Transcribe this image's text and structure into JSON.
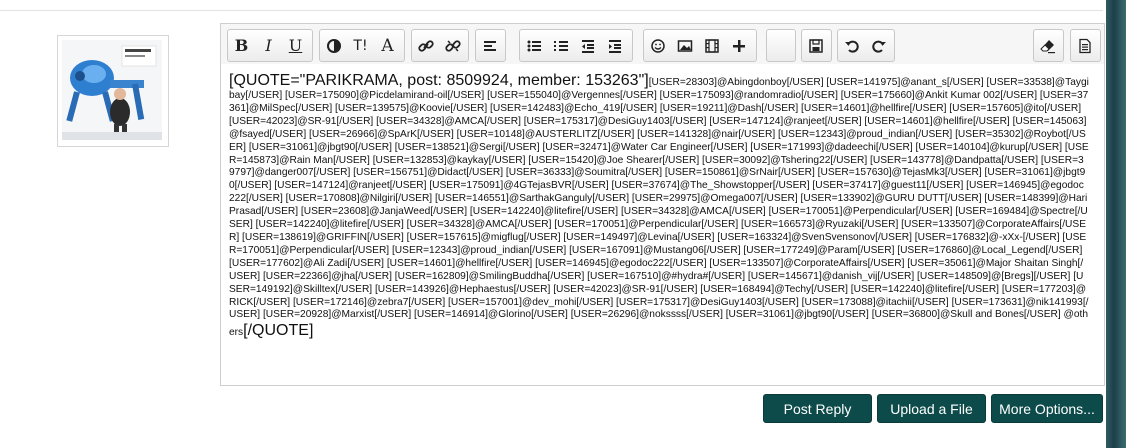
{
  "toolbar": {
    "icons": [
      "bold-icon",
      "italic-icon",
      "underline-icon",
      "color-icon",
      "text-size-icon",
      "font-icon",
      "link-icon",
      "unlink-icon",
      "align-icon",
      "bullet-list-icon",
      "numbered-list-icon",
      "outdent-icon",
      "indent-icon",
      "smilie-icon",
      "image-icon",
      "media-icon",
      "insert-icon",
      "blank",
      "save-icon",
      "undo-icon",
      "redo-icon",
      "remove-format-icon",
      "source-icon"
    ],
    "bold_label": "B",
    "italic_label": "I",
    "underline_label": "U",
    "size_label": "T!",
    "font_label": "A"
  },
  "editor": {
    "quote_open": "[QUOTE=\"PARIKRAMA, post: 8509924, member: 153263\"]",
    "body_text": "[USER=28303]@Abingdonboy[/USER] [USER=141975]@anant_s[/USER] [USER=33538]@Taygibay[/USER] [USER=175090]@Picdelamirand-oil[/USER] [USER=155040]@Vergennes[/USER] [USER=175093]@randomradio[/USER] [USER=175660]@Ankit Kumar 002[/USER] [USER=37361]@MilSpec[/USER] [USER=139575]@Koovie[/USER] [USER=142483]@Echo_419[/USER] [USER=19211]@Dash[/USER] [USER=14601]@hellfire[/USER] [USER=157605]@ito[/USER] [USER=42023]@SR-91[/USER] [USER=34328]@AMCA[/USER] [USER=175317]@DesiGuy1403[/USER] [USER=147124]@ranjeet[/USER] [USER=14601]@hellfire[/USER] [USER=145063]@fsayed[/USER] [USER=26966]@SpArK[/USER] [USER=10148]@AUSTERLITZ[/USER] [USER=141328]@nair[/USER] [USER=12343]@proud_indian[/USER] [USER=35302]@Roybot[/USER] [USER=31061]@jbgt90[/USER] [USER=138521]@Sergi[/USER] [USER=32471]@Water Car Engineer[/USER] [USER=171993]@dadeechi[/USER] [USER=140104]@kurup[/USER] [USER=145873]@Rain Man[/USER] [USER=132853]@kaykay[/USER] [USER=15420]@Joe Shearer[/USER] [USER=30092]@Tshering22[/USER] [USER=143778]@Dandpatta[/USER] [USER=39797]@danger007[/USER] [USER=156751]@Didact[/USER] [USER=36333]@Soumitra[/USER] [USER=150861]@SrNair[/USER] [USER=157630]@TejasMk3[/USER] [USER=31061]@jbgt90[/USER] [USER=147124]@ranjeet[/USER] [USER=175091]@4GTejasBVR[/USER] [USER=37674]@The_Showstopper[/USER] [USER=37417]@guest11[/USER] [USER=146945]@egodoc222[/USER] [USER=170808]@Nilgiri[/USER] [USER=146551]@SarthakGanguly[/USER] [USER=29975]@Omega007[/USER] [USER=133902]@GURU DUTT[/USER] [USER=148399]@HariPrasad[/USER] [USER=23608]@JanjaWeed[/USER] [USER=142240]@litefire[/USER] [USER=34328]@AMCA[/USER] [USER=170051]@Perpendicular[/USER] [USER=169484]@Spectre[/USER] [USER=142240]@litefire[/USER] [USER=34328]@AMCA[/USER] [USER=170051]@Perpendicular[/USER] [USER=166573]@Ryuzaki[/USER] [USER=133507]@CorporateAffairs[/USER] [USER=138619]@GRIFFIN[/USER] [USER=157615]@migflug[/USER] [USER=149497]@Levina[/USER] [USER=163324]@SvenSvensonov[/USER] [USER=176832]@-xXx-[/USER] [USER=170051]@Perpendicular[/USER] [USER=12343]@proud_indian[/USER] [USER=167091]@Mustang06[/USER] [USER=177249]@Param[/USER] [USER=176860]@Local_Legend[/USER] [USER=177602]@Ali Zadi[/USER] [USER=14601]@hellfire[/USER] [USER=146945]@egodoc222[/USER] [USER=133507]@CorporateAffairs[/USER] [USER=35061]@Major Shaitan Singh[/USER] [USER=22366]@jha[/USER] [USER=162809]@SmilingBuddha[/USER] [USER=167510]@#hydra#[/USER] [USER=145671]@danish_vij[/USER] [USER=148509]@[Bregs][/USER] [USER=149192]@Skilltex[/USER] [USER=143926]@Hephaestus[/USER] [USER=42023]@SR-91[/USER] [USER=168494]@Techy[/USER] [USER=142240]@litefire[/USER] [USER=177203]@RICK[/USER] [USER=172146]@zebra7[/USER] [USER=157001]@dev_mohi[/USER] [USER=175317]@DesiGuy1403[/USER] [USER=173088]@itachii[/USER] [USER=173631]@nik141993[/USER] [USER=20928]@Marxist[/USER] [USER=146914]@Glorino[/USER] [USER=26296]@nokssss[/USER] [USER=31061]@jbgt90[/USER] [USER=36800]@Skull and Bones[/USER] @others",
    "quote_close": "[/QUOTE]"
  },
  "buttons": {
    "post_reply": "Post Reply",
    "upload_file": "Upload a File",
    "more_options": "More Options..."
  },
  "colors": {
    "button_bg": "#0d4b4b",
    "spell_underline": "#cc3333"
  }
}
